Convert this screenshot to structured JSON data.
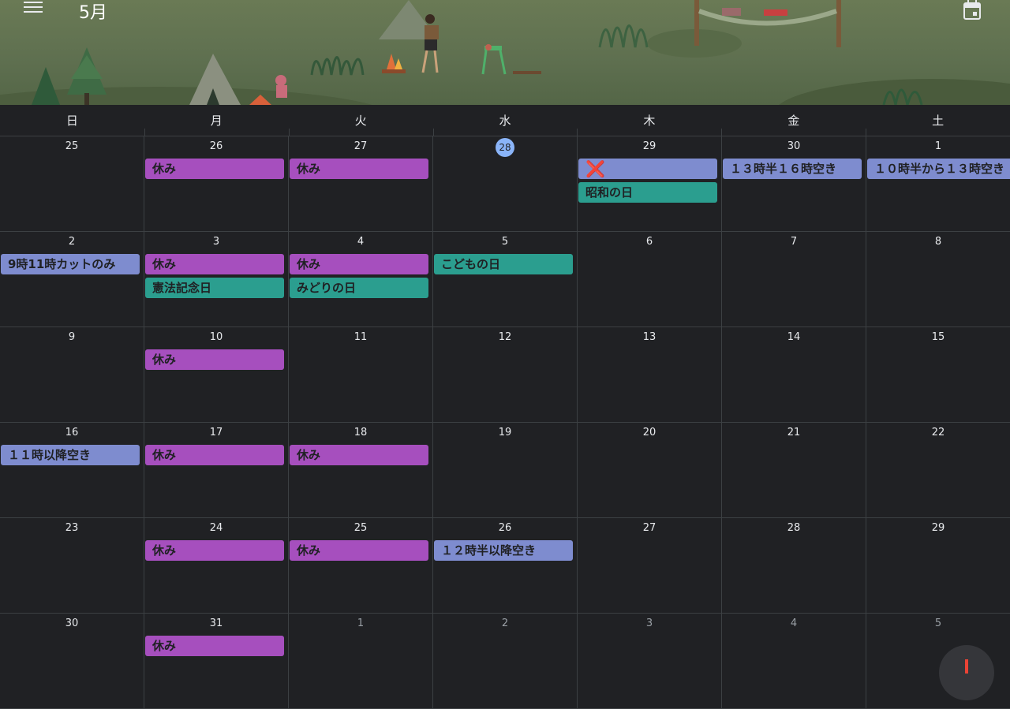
{
  "header": {
    "month_title": "5月",
    "menu_icon": "hamburger-menu-icon",
    "today_icon": "calendar-today-icon"
  },
  "weekdays": [
    "日",
    "月",
    "火",
    "水",
    "木",
    "金",
    "土"
  ],
  "weeks": [
    [
      {
        "num": "25",
        "dim": false,
        "events": []
      },
      {
        "num": "26",
        "dim": false,
        "events": [
          {
            "label": "休み",
            "color": "purple"
          }
        ]
      },
      {
        "num": "27",
        "dim": false,
        "events": [
          {
            "label": "休み",
            "color": "purple"
          }
        ]
      },
      {
        "num": "28",
        "dim": false,
        "today": true,
        "events": []
      },
      {
        "num": "29",
        "dim": false,
        "events": [
          {
            "label": "❌",
            "color": "blue",
            "icon": "cross-mark-icon"
          },
          {
            "label": "昭和の日",
            "color": "teal"
          }
        ]
      },
      {
        "num": "30",
        "dim": false,
        "events": [
          {
            "label": "１３時半１６時空き",
            "color": "blue"
          }
        ]
      },
      {
        "num": "1",
        "dim": false,
        "events": [
          {
            "label": "１０時半から１３時空き",
            "color": "blue"
          }
        ]
      }
    ],
    [
      {
        "num": "2",
        "dim": false,
        "events": [
          {
            "label": "9時11時カットのみ",
            "color": "blue"
          }
        ]
      },
      {
        "num": "3",
        "dim": false,
        "events": [
          {
            "label": "休み",
            "color": "purple"
          },
          {
            "label": "憲法記念日",
            "color": "teal"
          }
        ]
      },
      {
        "num": "4",
        "dim": false,
        "events": [
          {
            "label": "休み",
            "color": "purple"
          },
          {
            "label": "みどりの日",
            "color": "teal"
          }
        ]
      },
      {
        "num": "5",
        "dim": false,
        "events": [
          {
            "label": "こどもの日",
            "color": "teal"
          }
        ]
      },
      {
        "num": "6",
        "dim": false,
        "events": []
      },
      {
        "num": "7",
        "dim": false,
        "events": []
      },
      {
        "num": "8",
        "dim": false,
        "events": []
      }
    ],
    [
      {
        "num": "9",
        "dim": false,
        "events": []
      },
      {
        "num": "10",
        "dim": false,
        "events": [
          {
            "label": "休み",
            "color": "purple"
          }
        ]
      },
      {
        "num": "11",
        "dim": false,
        "events": []
      },
      {
        "num": "12",
        "dim": false,
        "events": []
      },
      {
        "num": "13",
        "dim": false,
        "events": []
      },
      {
        "num": "14",
        "dim": false,
        "events": []
      },
      {
        "num": "15",
        "dim": false,
        "events": []
      }
    ],
    [
      {
        "num": "16",
        "dim": false,
        "events": [
          {
            "label": "１１時以降空き",
            "color": "blue"
          }
        ]
      },
      {
        "num": "17",
        "dim": false,
        "events": [
          {
            "label": "休み",
            "color": "purple"
          }
        ]
      },
      {
        "num": "18",
        "dim": false,
        "events": [
          {
            "label": "休み",
            "color": "purple"
          }
        ]
      },
      {
        "num": "19",
        "dim": false,
        "events": []
      },
      {
        "num": "20",
        "dim": false,
        "events": []
      },
      {
        "num": "21",
        "dim": false,
        "events": []
      },
      {
        "num": "22",
        "dim": false,
        "events": []
      }
    ],
    [
      {
        "num": "23",
        "dim": false,
        "events": []
      },
      {
        "num": "24",
        "dim": false,
        "events": [
          {
            "label": "休み",
            "color": "purple"
          }
        ]
      },
      {
        "num": "25",
        "dim": false,
        "events": [
          {
            "label": "休み",
            "color": "purple"
          }
        ]
      },
      {
        "num": "26",
        "dim": false,
        "events": [
          {
            "label": "１２時半以降空き",
            "color": "blue"
          }
        ]
      },
      {
        "num": "27",
        "dim": false,
        "events": []
      },
      {
        "num": "28",
        "dim": false,
        "events": []
      },
      {
        "num": "29",
        "dim": false,
        "events": []
      }
    ],
    [
      {
        "num": "30",
        "dim": false,
        "events": []
      },
      {
        "num": "31",
        "dim": false,
        "events": [
          {
            "label": "休み",
            "color": "purple"
          }
        ]
      },
      {
        "num": "1",
        "dim": true,
        "events": []
      },
      {
        "num": "2",
        "dim": true,
        "events": []
      },
      {
        "num": "3",
        "dim": true,
        "events": []
      },
      {
        "num": "4",
        "dim": true,
        "events": []
      },
      {
        "num": "5",
        "dim": true,
        "events": []
      }
    ]
  ],
  "fab_icon": "create-event-plus-icon"
}
